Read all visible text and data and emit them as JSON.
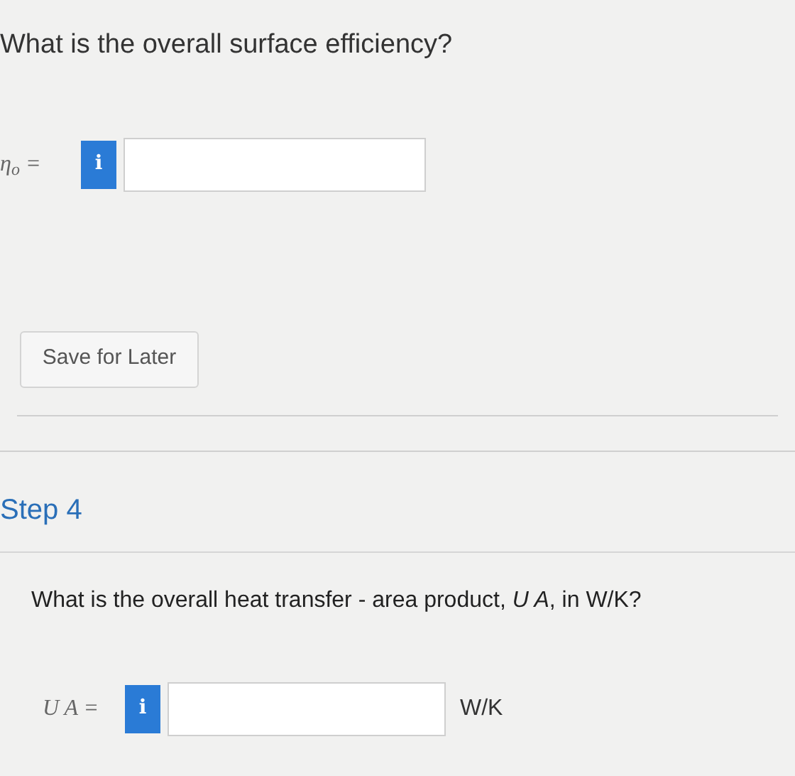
{
  "question": "What is the overall surface efficiency?",
  "field_1": {
    "label": "η$_{o}$ =",
    "info": "i"
  },
  "save_button": "Save for Later",
  "step_title": "Step 4",
  "step_question": "What is the overall heat transfer - area product, *U A*, in W/K?",
  "field_2": {
    "label": "U A =",
    "info": "i",
    "unit": "W/K"
  }
}
